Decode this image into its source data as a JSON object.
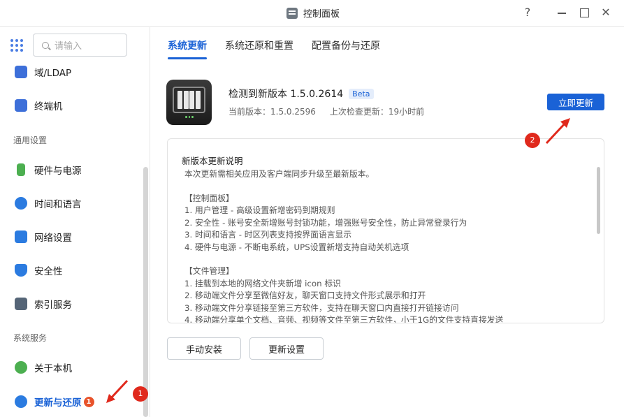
{
  "window": {
    "title": "控制面板",
    "help": "?",
    "close": "✕"
  },
  "sidebar": {
    "search_placeholder": "请输入",
    "items_top": [
      {
        "label": "域/LDAP",
        "color": "#3d6fd9"
      },
      {
        "label": "终端机",
        "color": "#3d6fd9"
      }
    ],
    "section_general": "通用设置",
    "items_general": [
      {
        "label": "硬件与电源",
        "color": "#4caf50"
      },
      {
        "label": "时间和语言",
        "color": "#2b7be0"
      },
      {
        "label": "网络设置",
        "color": "#2b7be0"
      },
      {
        "label": "安全性",
        "color": "#2b7be0"
      },
      {
        "label": "索引服务",
        "color": "#556577"
      }
    ],
    "section_services": "系统服务",
    "items_services": [
      {
        "label": "关于本机",
        "color": "#4caf50"
      },
      {
        "label": "更新与还原",
        "color": "#2b7be0",
        "badge": "1"
      }
    ]
  },
  "tabs": [
    "系统更新",
    "系统还原和重置",
    "配置备份与还原"
  ],
  "update": {
    "title": "检测到新版本 1.5.0.2614",
    "tag": "Beta",
    "current_version": "当前版本：1.5.0.2596",
    "last_check": "上次检查更新：19小时前",
    "update_now": "立即更新"
  },
  "notes": {
    "title": "新版本更新说明",
    "intro": "本次更新需相关应用及客户端同步升级至最新版本。",
    "sections": [
      {
        "heading": "【控制面板】",
        "lines": [
          "1. 用户管理 - 高级设置新增密码到期规则",
          "2. 安全性 - 账号安全新增账号封锁功能，增强账号安全性，防止异常登录行为",
          "3. 时间和语言 - 时区列表支持按界面语言显示",
          "4. 硬件与电源 - 不断电系统，UPS设置新增支持自动关机选项"
        ]
      },
      {
        "heading": "【文件管理】",
        "lines": [
          "1. 挂载到本地的网络文件夹新增 icon 标识",
          "2. 移动端文件分享至微信好友，聊天窗口支持文件形式展示和打开",
          "3. 移动端文件分享链接至第三方软件，支持在聊天窗口内直接打开链接访问",
          "4. 移动端分享单个文档、音频、视频等文件至第三方软件，小于1G的文件支持直接发送"
        ]
      }
    ]
  },
  "buttons": {
    "manual_install": "手动安装",
    "update_settings": "更新设置"
  },
  "annotations": [
    "1",
    "2"
  ],
  "colors": {
    "accent": "#1a62d6",
    "annotation": "#e0291c"
  }
}
